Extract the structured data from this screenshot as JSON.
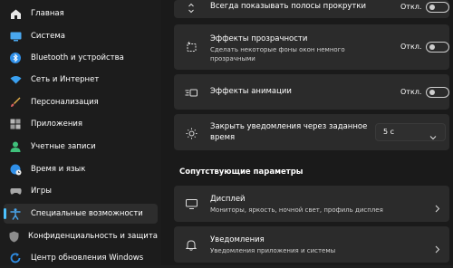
{
  "sidebar": {
    "items": [
      {
        "label": "Главная",
        "icon": "home-icon"
      },
      {
        "label": "Система",
        "icon": "system-icon"
      },
      {
        "label": "Bluetooth и устройства",
        "icon": "bluetooth-icon"
      },
      {
        "label": "Сеть и Интернет",
        "icon": "wifi-icon"
      },
      {
        "label": "Персонализация",
        "icon": "brush-icon"
      },
      {
        "label": "Приложения",
        "icon": "apps-icon"
      },
      {
        "label": "Учетные записи",
        "icon": "person-icon"
      },
      {
        "label": "Время и язык",
        "icon": "globe-clock-icon"
      },
      {
        "label": "Игры",
        "icon": "gamepad-icon"
      },
      {
        "label": "Специальные возможности",
        "icon": "accessibility-icon",
        "selected": true
      },
      {
        "label": "Конфиденциальность и защита",
        "icon": "shield-icon"
      },
      {
        "label": "Центр обновления Windows",
        "icon": "update-icon"
      }
    ],
    "accent": "#4cc2ff"
  },
  "main": {
    "scrollbars": {
      "title": "Всегда показывать полосы прокрутки",
      "state": "Откл."
    },
    "transparency": {
      "title": "Эффекты прозрачности",
      "subtitle_line1": "Сделать некоторые фоны окон немного",
      "subtitle_line2": "прозрачными",
      "state": "Откл."
    },
    "animation": {
      "title": "Эффекты анимации",
      "state": "Откл."
    },
    "notifications": {
      "title_line1": "Закрыть уведомления через заданное",
      "title_line2": "время",
      "value": "5 с"
    },
    "related_title": "Сопутствующие параметры",
    "display": {
      "title": "Дисплей",
      "subtitle": "Мониторы, яркость, ночной свет, профиль дисплея"
    },
    "notif_link": {
      "title": "Уведомления",
      "subtitle": "Уведомления приложения и системы"
    }
  }
}
